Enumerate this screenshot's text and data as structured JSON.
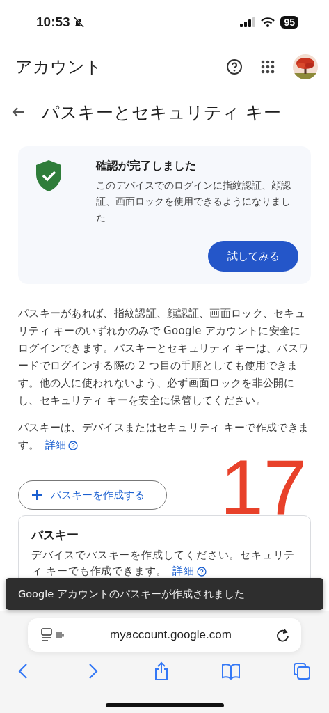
{
  "status_bar": {
    "time": "10:53",
    "battery": "95"
  },
  "header": {
    "title": "アカウント"
  },
  "page_title": "パスキーとセキュリティ キー",
  "verification_card": {
    "title": "確認が完了しました",
    "body": "このデバイスでのログインに指紋認証、顔認証、画面ロックを使用できるようになりました",
    "button": "試してみる"
  },
  "description": [
    "パスキーがあれば、指紋認証、顔認証、画面ロック、セキュリティ キーのいずれかのみで Google アカウントに安全にログインできます。パスキーとセキュリティ キーは、パスワードでログインする際の 2 つ目の手順としても使用できます。他の人に使われないよう、必ず画面ロックを非公開にし、セキュリティ キーを安全に保管してください。",
    "パスキーは、デバイスまたはセキュリティ キーで作成できます。"
  ],
  "description_link": "詳細",
  "create_button": "パスキーを作成する",
  "passkey_card": {
    "title": "パスキー",
    "body": "デバイスでパスキーを作成してください。セキュリティ キーでも作成できます。",
    "link": "詳細"
  },
  "annotation": "17",
  "toast": "Google アカウントのパスキーが作成されました",
  "browser": {
    "url": "myaccount.google.com"
  }
}
